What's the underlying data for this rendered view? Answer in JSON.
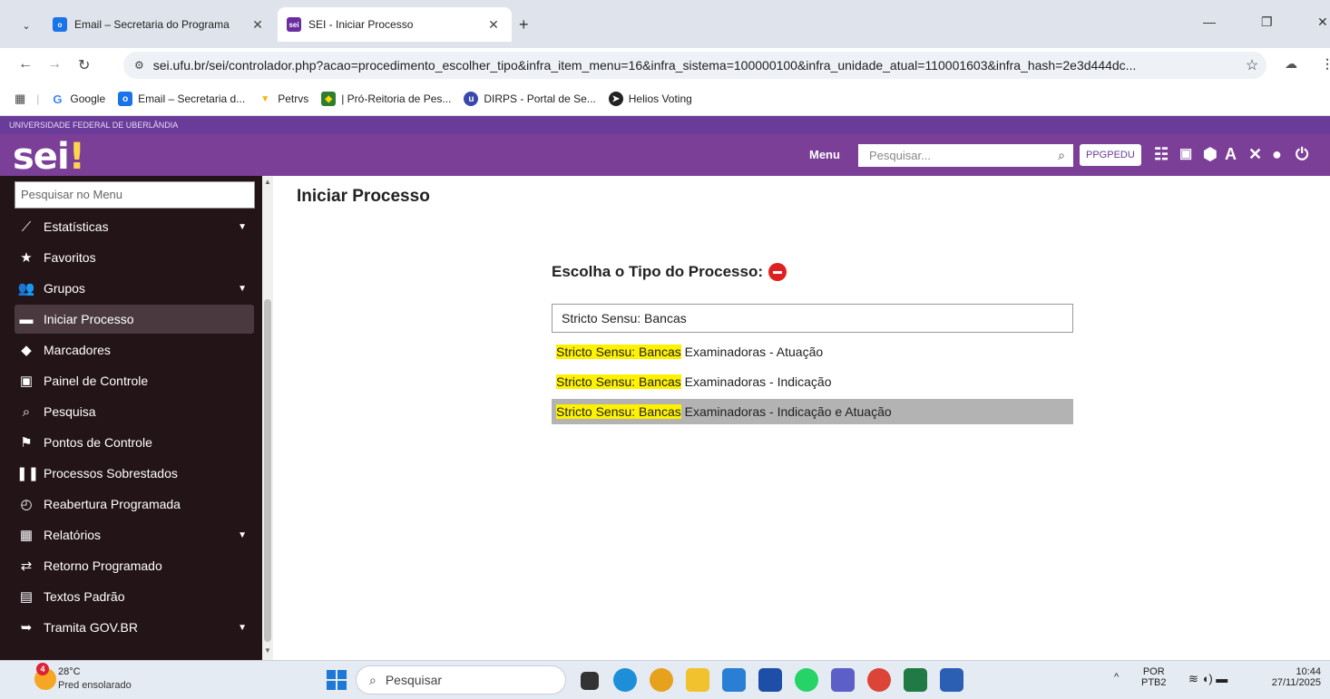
{
  "browser": {
    "tabs": [
      {
        "title": "Email – Secretaria do Programa",
        "active": false
      },
      {
        "title": "SEI - Iniciar Processo",
        "active": true
      }
    ],
    "url": "sei.ufu.br/sei/controlador.php?acao=procedimento_escolher_tipo&infra_item_menu=16&infra_sistema=100000100&infra_unidade_atual=110001603&infra_hash=2e3d444dc...",
    "bookmarks": [
      {
        "label": "Google",
        "icon": "google-icon",
        "color": "#4285f4"
      },
      {
        "label": "Email – Secretaria d...",
        "icon": "outlook-icon",
        "color": "#1a73e8"
      },
      {
        "label": "Petrvs",
        "icon": "petrvs-icon",
        "color": "#f2b400"
      },
      {
        "label": "| Pró-Reitoria de Pes...",
        "icon": "flag-icon",
        "color": "#2e7d32"
      },
      {
        "label": "DIRPS - Portal de Se...",
        "icon": "dirps-icon",
        "color": "#3949ab"
      },
      {
        "label": "Helios Voting",
        "icon": "helios-icon",
        "color": "#222222"
      }
    ]
  },
  "sei": {
    "institution": "UNIVERSIDADE FEDERAL DE UBERLÂNDIA",
    "logo_text": "sei",
    "logo_dot": "!",
    "menu_label": "Menu",
    "search_placeholder": "Pesquisar...",
    "unit": "PPGPEDU",
    "colors": {
      "header": "#7b3f98",
      "top_strip": "#6a3c9a",
      "sidebar": "#231418",
      "highlight": "#fff200"
    }
  },
  "sidebar": {
    "search_placeholder": "Pesquisar no Menu",
    "items": [
      {
        "label": "Estatísticas",
        "icon": "chart-line-icon",
        "expandable": true
      },
      {
        "label": "Favoritos",
        "icon": "star-icon",
        "expandable": false
      },
      {
        "label": "Grupos",
        "icon": "group-icon",
        "expandable": true
      },
      {
        "label": "Iniciar Processo",
        "icon": "folder-icon",
        "expandable": false,
        "selected": true
      },
      {
        "label": "Marcadores",
        "icon": "tag-icon",
        "expandable": false
      },
      {
        "label": "Painel de Controle",
        "icon": "panel-123-icon",
        "expandable": false
      },
      {
        "label": "Pesquisa",
        "icon": "search-icon",
        "expandable": false
      },
      {
        "label": "Pontos de Controle",
        "icon": "flag-icon",
        "expandable": false
      },
      {
        "label": "Processos Sobrestados",
        "icon": "pause-icon",
        "expandable": false
      },
      {
        "label": "Reabertura Programada",
        "icon": "folder-clock-icon",
        "expandable": false
      },
      {
        "label": "Relatórios",
        "icon": "table-icon",
        "expandable": true
      },
      {
        "label": "Retorno Programado",
        "icon": "swap-arrows-icon",
        "expandable": false
      },
      {
        "label": "Textos Padrão",
        "icon": "document-icon",
        "expandable": false
      },
      {
        "label": "Tramita GOV.BR",
        "icon": "folder-send-icon",
        "expandable": true
      }
    ]
  },
  "main": {
    "title": "Iniciar Processo",
    "choose_label": "Escolha o Tipo do Processo:",
    "filter_value": "Stricto Sensu: Bancas",
    "results": [
      {
        "match": "Stricto Sensu: Bancas",
        "rest": " Examinadoras - Atuação",
        "hovered": false
      },
      {
        "match": "Stricto Sensu: Bancas",
        "rest": " Examinadoras - Indicação",
        "hovered": false
      },
      {
        "match": "Stricto Sensu: Bancas",
        "rest": " Examinadoras - Indicação e Atuação",
        "hovered": true
      }
    ]
  },
  "taskbar": {
    "weather_badge": "4",
    "temperature": "28°C",
    "weather_desc": "Pred ensolarado",
    "search_placeholder": "Pesquisar",
    "language": "POR",
    "layout": "PTB2",
    "time": "10:44",
    "date": "27/11/2025"
  }
}
